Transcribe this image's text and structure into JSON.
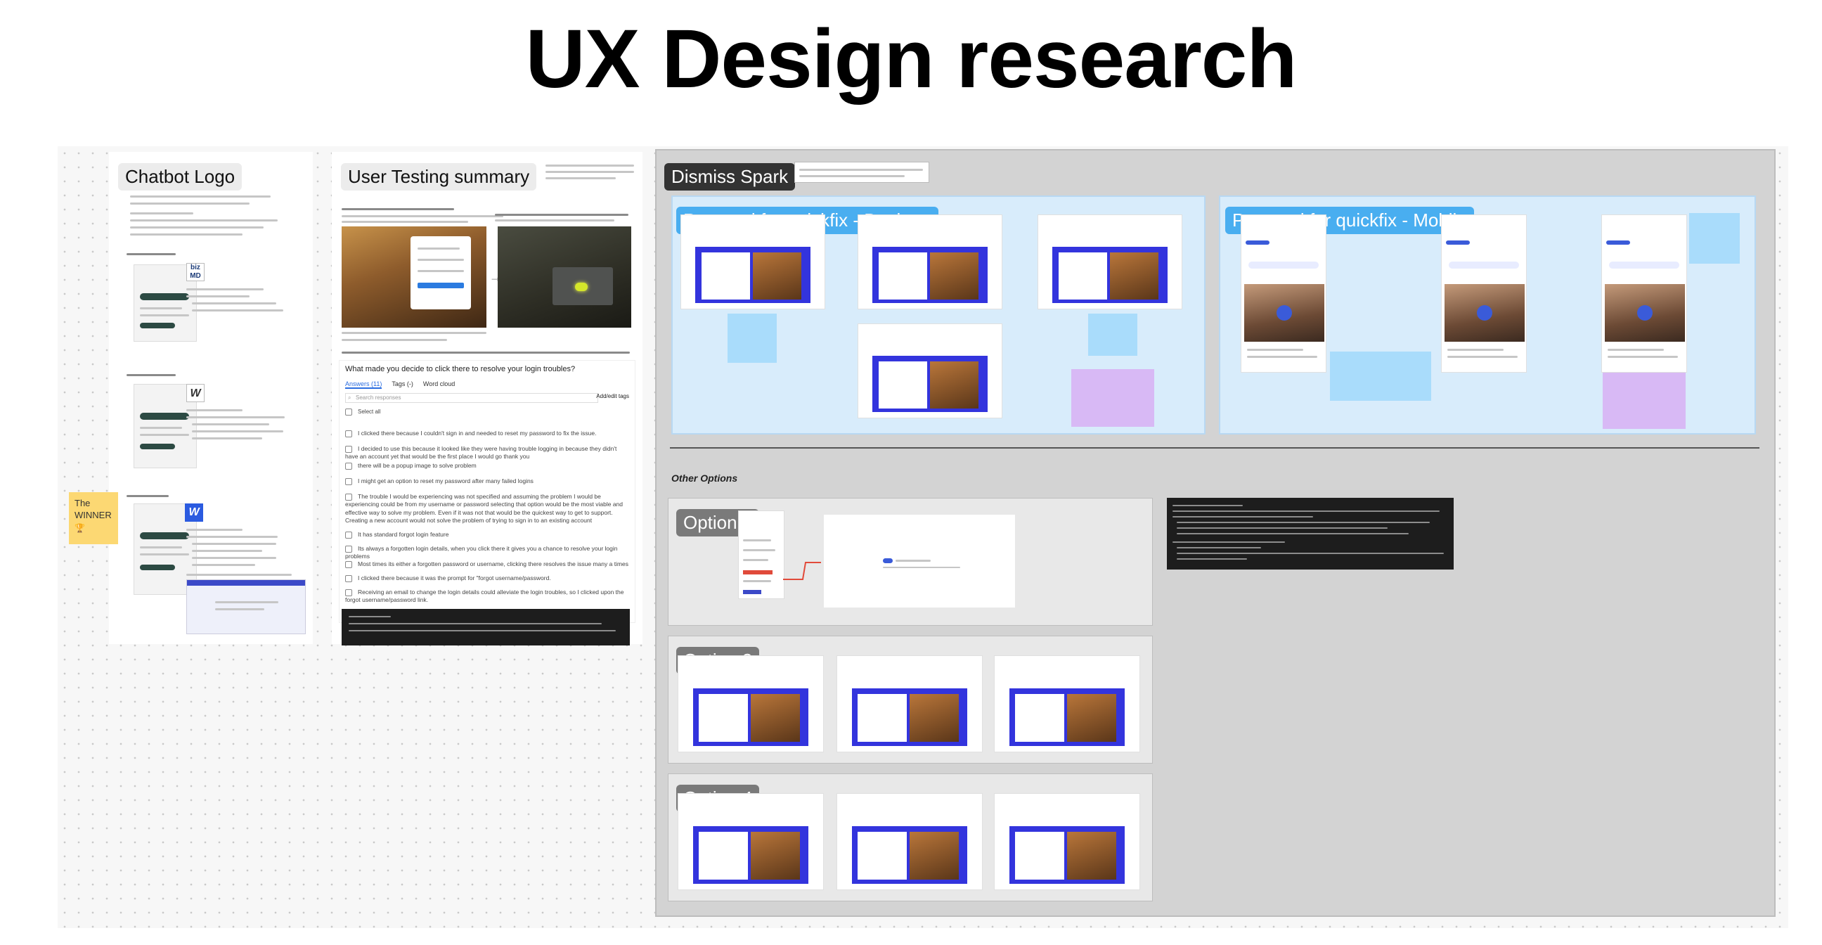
{
  "page": {
    "title": "UX Design research"
  },
  "frames": {
    "chatbot_logo": {
      "label": "Chatbot Logo"
    },
    "user_testing": {
      "label": "User Testing summary",
      "question": "What made you decide to click there to resolve your login troubles?",
      "tabs": [
        "Answers (11)",
        "Tags (-)",
        "Word cloud"
      ],
      "search_placeholder": "Search responses",
      "add_tags": "Add/edit tags",
      "select_all": "Select all",
      "answers": [
        "I clicked there because I couldn't sign in and needed to reset my password to fix the issue.",
        "I decided to use this because it looked like they were having trouble logging in because they didn't have an account yet that would be the first place I would go thank you",
        "there will be a popup image to solve problem",
        "I might get an option to reset my password after many failed logins",
        "The trouble I would be experiencing was not specified and assuming the problem I would be experiencing could be from my username or password selecting that option would be the most viable and effective way to solve my problem. Even if it was not that would be the quickest way to get to support. Creating a new account would not solve the problem of trying to sign in to an existing account",
        "It has standard forgot login feature",
        "Its always a forgotten login details, when you click there it gives you a chance to resolve your login problems",
        "Most times its either a forgotten password or username, clicking there resolves the issue many a times",
        "I clicked there because it was the prompt for \"forgot username/password.",
        "Receiving an email to change the login details could alleviate the login troubles, so I clicked upon the forgot username/password link."
      ]
    },
    "dismiss_spark": {
      "label": "Dismiss Spark"
    },
    "proposal_desktop": {
      "label": "Proposal for quickfix - Desktop"
    },
    "proposal_mobile": {
      "label": "Proposal for quickfix - Mobile"
    },
    "other_options": {
      "heading": "Other Options"
    },
    "options": [
      {
        "label": "Option 2"
      },
      {
        "label": "Option 3"
      },
      {
        "label": "Option 4"
      }
    ]
  },
  "sticky_winner": {
    "text": "The WINNER"
  },
  "colors": {
    "accent_blue": "#49aef0",
    "sticky_yellow": "#fcd873",
    "sticky_blue": "#a9dcfb",
    "sticky_purple": "#d8b9f5",
    "brand_blue": "#3334dd"
  }
}
